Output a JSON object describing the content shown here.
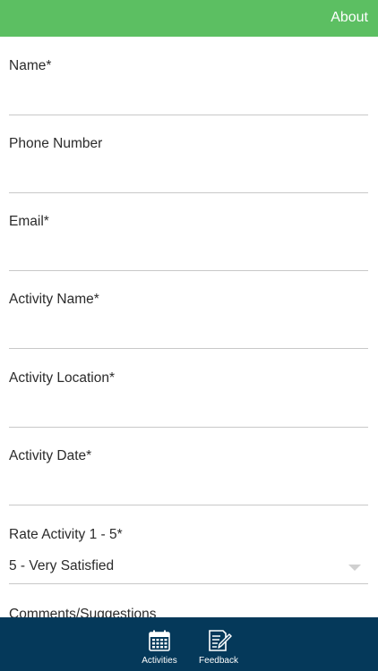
{
  "header": {
    "about_label": "About"
  },
  "form": {
    "fields": [
      {
        "label": "Name*",
        "value": ""
      },
      {
        "label": "Phone Number",
        "value": ""
      },
      {
        "label": "Email*",
        "value": ""
      },
      {
        "label": "Activity Name*",
        "value": ""
      },
      {
        "label": "Activity Location*",
        "value": ""
      },
      {
        "label": "Activity Date*",
        "value": ""
      }
    ],
    "rating": {
      "label": "Rate Activity 1 - 5*",
      "selected": "5 - Very Satisfied"
    },
    "comments_label": "Comments/Suggestions"
  },
  "nav": {
    "activities": {
      "label": "Activities",
      "icon": "calendar-icon"
    },
    "feedback": {
      "label": "Feedback",
      "icon": "feedback-form-icon"
    }
  },
  "colors": {
    "header": "#5cbf62",
    "bottom_nav": "#05395a",
    "divider": "#c8c8c8"
  }
}
